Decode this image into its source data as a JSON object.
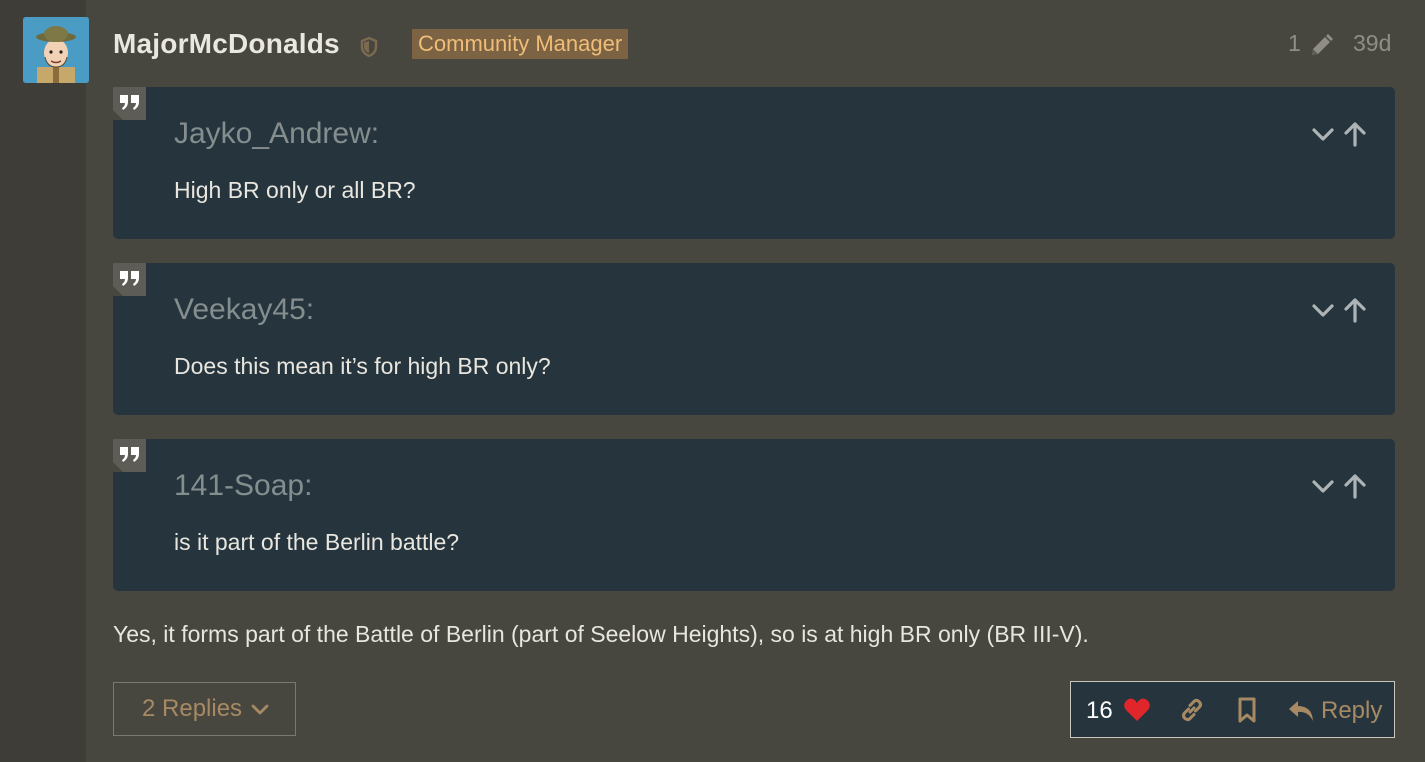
{
  "post": {
    "username": "MajorMcDonalds",
    "user_title": "Community Manager",
    "edit_count": "1",
    "age": "39d",
    "body": "Yes, it forms part of the Battle of Berlin (part of Seelow Heights), so is at high BR only (BR III-V)."
  },
  "quotes": [
    {
      "author": "Jayko_Andrew:",
      "text": "High BR only or all BR?"
    },
    {
      "author": "Veekay45:",
      "text": "Does this mean it’s for high BR only?"
    },
    {
      "author": "141-Soap:",
      "text": "is it part of the Berlin battle?"
    }
  ],
  "footer": {
    "replies_label": "2 Replies",
    "like_count": "16",
    "reply_label": "Reply"
  },
  "colors": {
    "background": "#47463f",
    "quote_background": "#26353d",
    "badge_background": "#7b6343",
    "badge_text": "#f0bd78",
    "accent_text": "#a78a63",
    "heart": "#e0262a"
  },
  "icons": {
    "mod_shield": "shield-icon",
    "edit": "pencil-icon",
    "quote": "quote-icon",
    "expand": "chevron-down-icon",
    "jump": "arrow-up-icon",
    "like": "heart-icon",
    "share": "link-icon",
    "bookmark": "bookmark-icon",
    "reply": "reply-icon"
  }
}
